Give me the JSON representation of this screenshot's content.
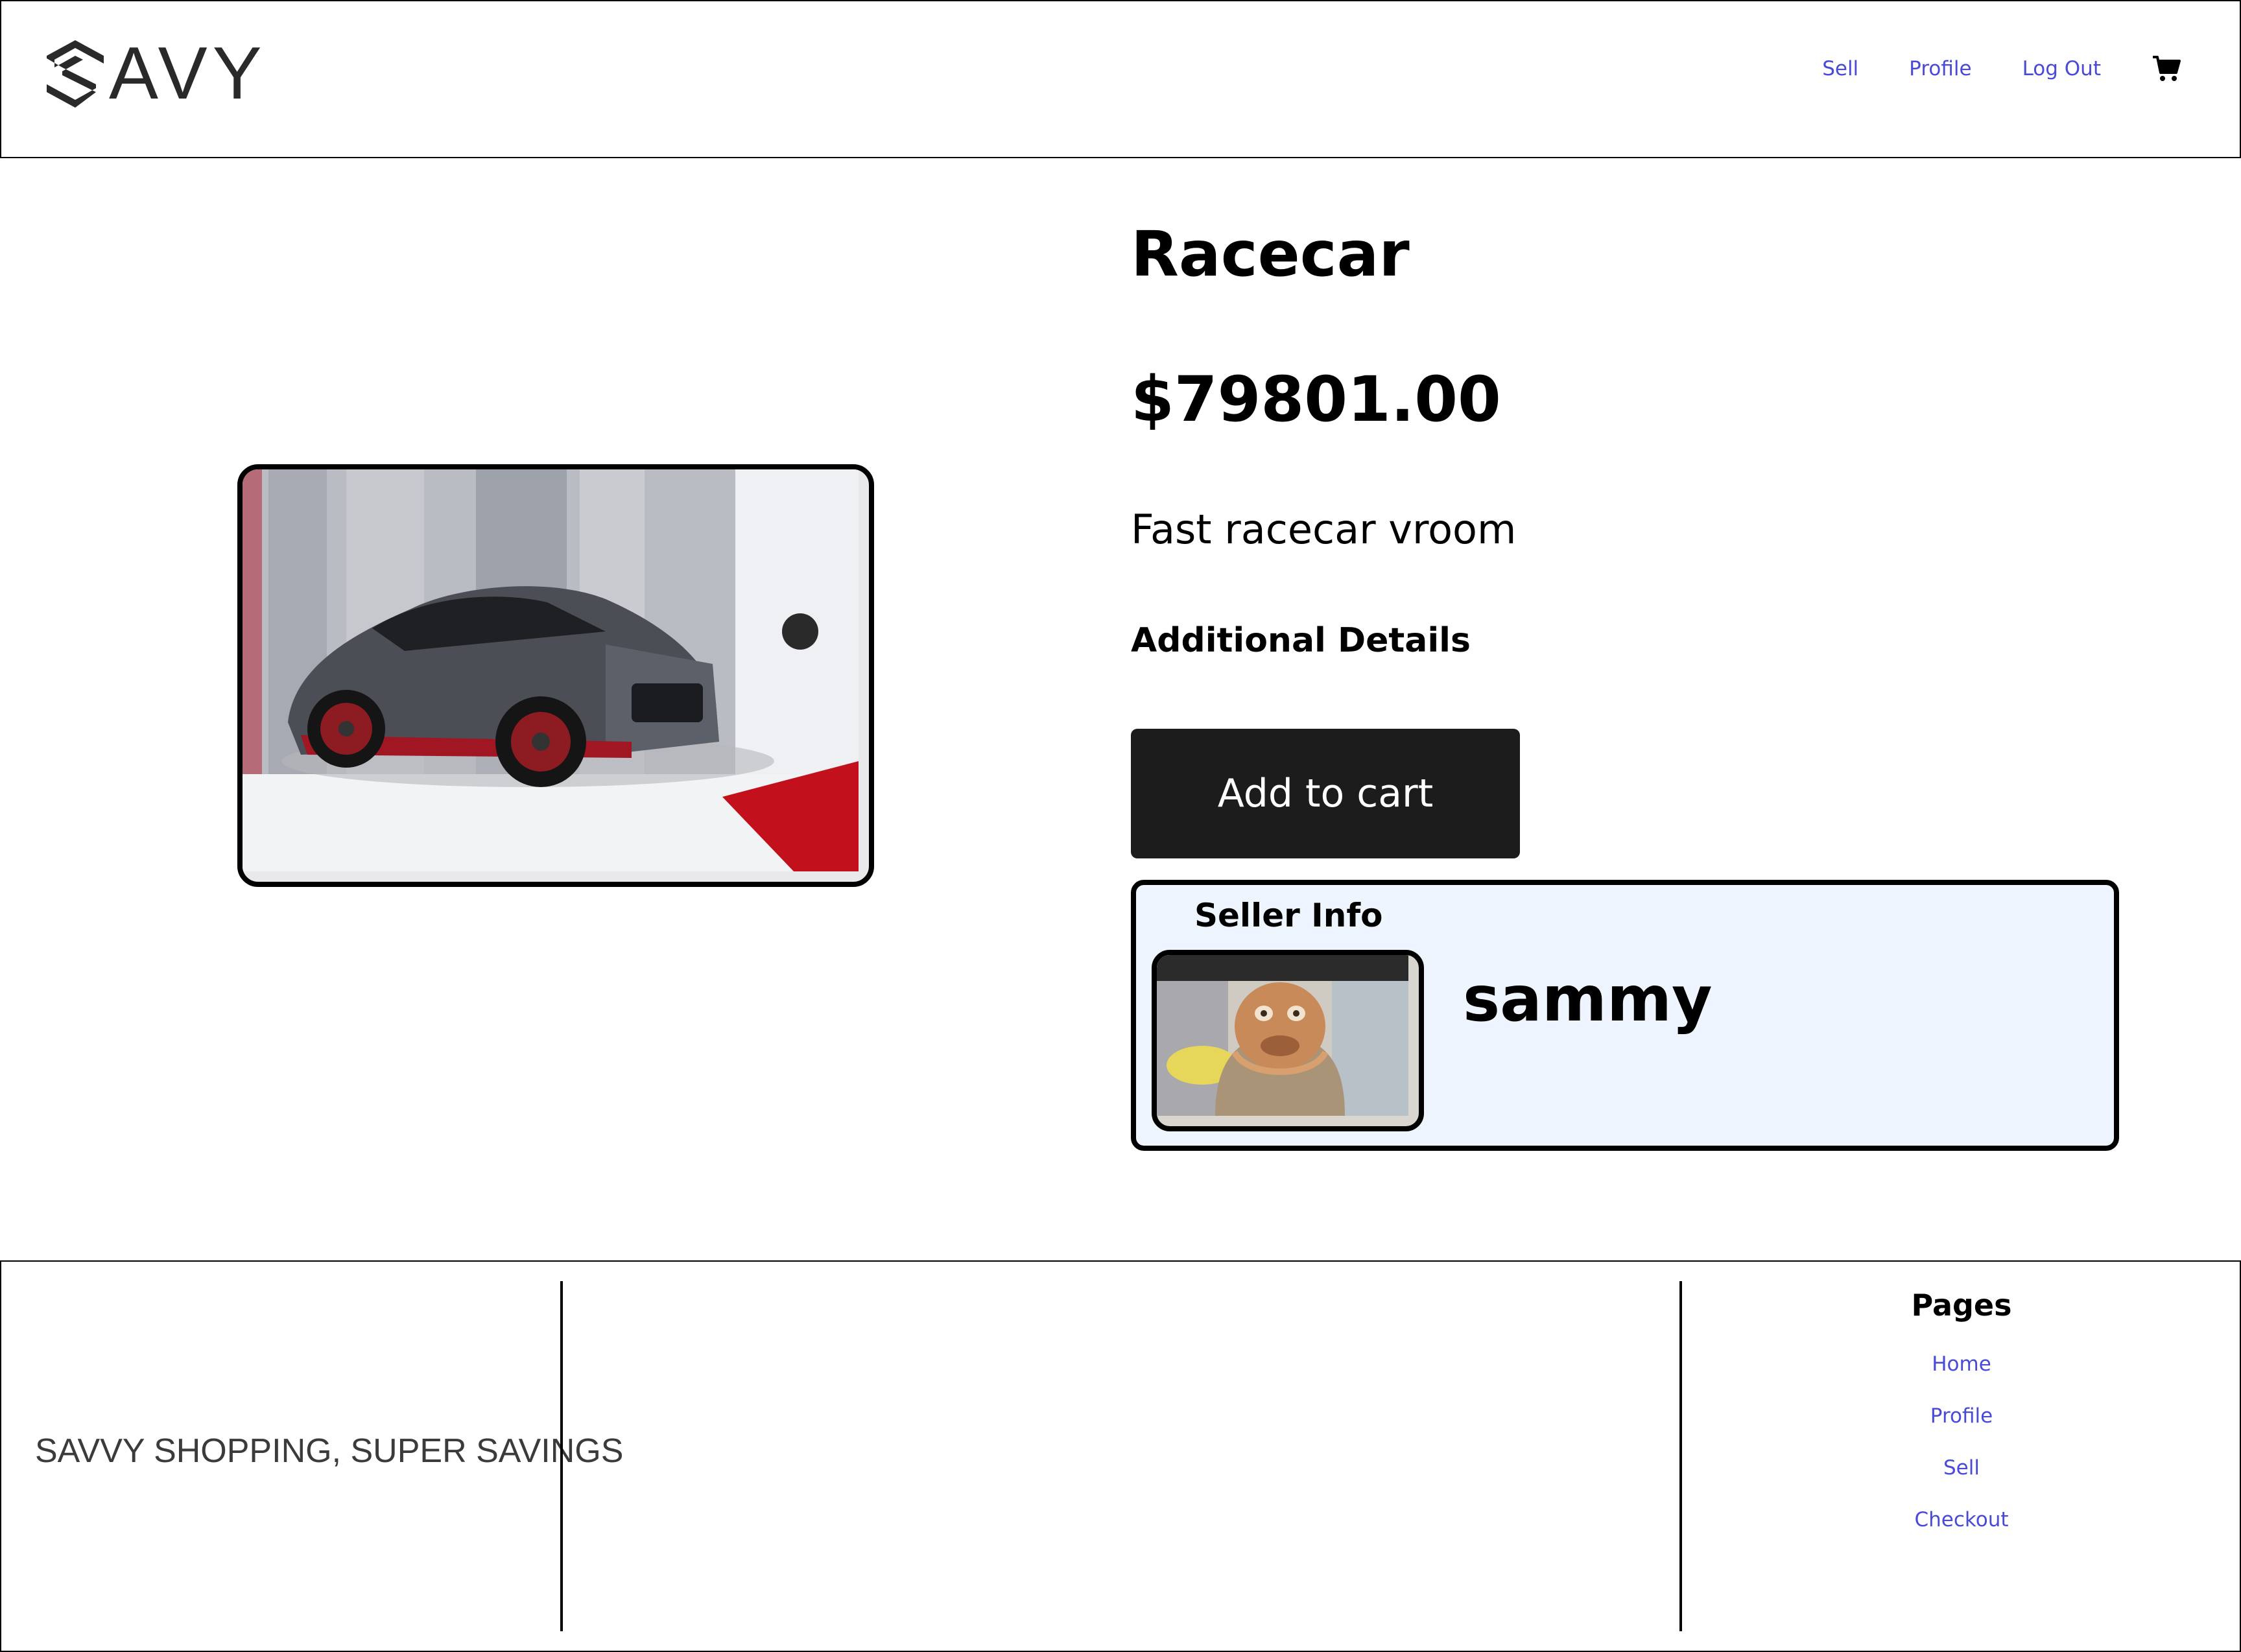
{
  "header": {
    "logo_text": "AVY",
    "nav": {
      "sell": "Sell",
      "profile": "Profile",
      "logout": "Log Out"
    },
    "cart_icon": "shopping-cart-icon"
  },
  "product": {
    "title": "Racecar",
    "price": "$79801.00",
    "description": "Fast racecar vroom",
    "additional_details_label": "Additional Details",
    "add_to_cart_label": "Add to cart"
  },
  "seller": {
    "heading": "Seller Info",
    "name": "sammy"
  },
  "footer": {
    "tagline": "SAVVY SHOPPING, SUPER SAVINGS",
    "pages_heading": "Pages",
    "links": [
      "Home",
      "Profile",
      "Sell",
      "Checkout"
    ]
  },
  "colors": {
    "link": "#4a4ad8",
    "button_bg": "#1c1c1c",
    "seller_bg": "#eef5ff"
  }
}
